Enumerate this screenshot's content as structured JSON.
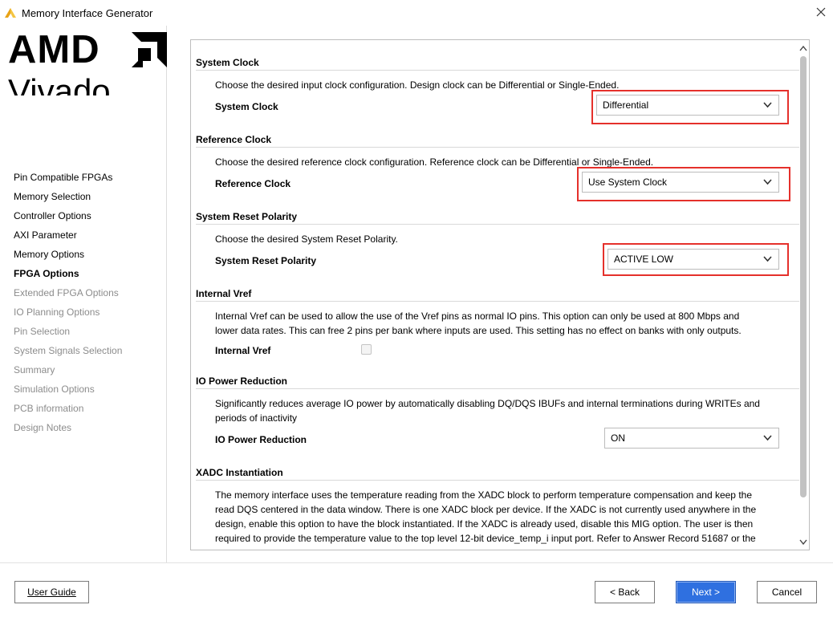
{
  "window": {
    "title": "Memory Interface Generator"
  },
  "brand": {
    "company": "AMD",
    "product": "Vivado"
  },
  "sidebar": {
    "items": [
      {
        "label": "Pin Compatible FPGAs",
        "state": "done"
      },
      {
        "label": "Memory Selection",
        "state": "done"
      },
      {
        "label": "Controller Options",
        "state": "done"
      },
      {
        "label": "AXI Parameter",
        "state": "done"
      },
      {
        "label": "Memory Options",
        "state": "done"
      },
      {
        "label": "FPGA Options",
        "state": "current"
      },
      {
        "label": "Extended FPGA Options",
        "state": "todo"
      },
      {
        "label": "IO Planning Options",
        "state": "todo"
      },
      {
        "label": "Pin Selection",
        "state": "todo"
      },
      {
        "label": "System Signals Selection",
        "state": "todo"
      },
      {
        "label": "Summary",
        "state": "todo"
      },
      {
        "label": "Simulation Options",
        "state": "todo"
      },
      {
        "label": "PCB information",
        "state": "todo"
      },
      {
        "label": "Design Notes",
        "state": "todo"
      }
    ]
  },
  "sections": {
    "system_clock": {
      "title": "System Clock",
      "description": "Choose the desired input clock configuration. Design clock can be Differential or Single-Ended.",
      "label": "System Clock",
      "value": "Differential"
    },
    "reference_clock": {
      "title": "Reference Clock",
      "description": "Choose the desired reference clock configuration. Reference clock can be Differential or Single-Ended.",
      "label": "Reference Clock",
      "value": "Use System Clock"
    },
    "reset_polarity": {
      "title": "System Reset Polarity",
      "description": "Choose the desired System Reset Polarity.",
      "label": "System Reset Polarity",
      "value": "ACTIVE LOW"
    },
    "internal_vref": {
      "title": "Internal Vref",
      "description_line1": "Internal Vref can be used to allow the use of the Vref pins as normal IO pins. This option can only be used at 800 Mbps and",
      "description_line2": "lower data rates. This can free 2 pins per bank where inputs are used. This setting has no effect on banks with only outputs.",
      "label": "Internal Vref",
      "checked": false
    },
    "io_power": {
      "title": "IO Power Reduction",
      "description_line1": "Significantly reduces average IO power by automatically disabling DQ/DQS IBUFs and internal terminations during WRITEs and",
      "description_line2": "periods of inactivity",
      "label": "IO Power Reduction",
      "value": "ON"
    },
    "xadc": {
      "title": "XADC Instantiation",
      "description_line1": "The memory interface uses the temperature reading from the XADC block to perform temperature compensation and keep the",
      "description_line2": "read DQS centered in the data window. There is one XADC block per device. If the XADC is not currently used anywhere in the",
      "description_line3": "design, enable this option to have the block instantiated. If the XADC is already used, disable this MIG option. The user is then",
      "description_line4": "required to provide the temperature value to the top level 12-bit device_temp_i input port. Refer to Answer Record 51687 or the"
    }
  },
  "footer": {
    "user_guide_label": "User Guide",
    "back_label": "< Back",
    "next_label": "Next >",
    "cancel_label": "Cancel"
  },
  "colors": {
    "highlight": "#e5302b",
    "primary_button": "#2f70e0"
  }
}
